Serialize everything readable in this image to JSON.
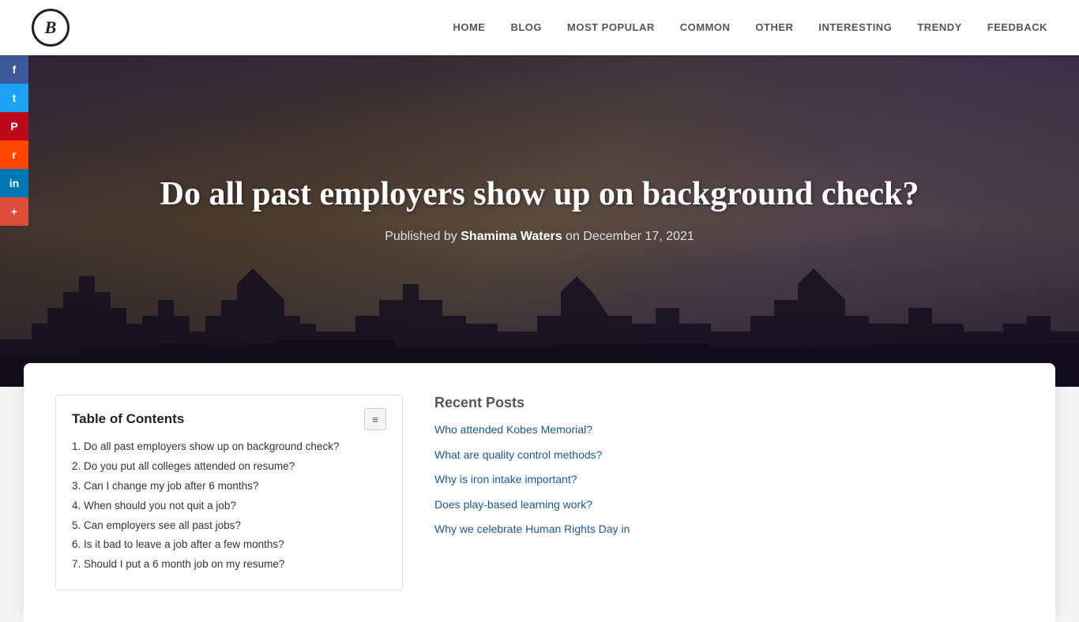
{
  "navbar": {
    "logo_letter": "B",
    "links": [
      {
        "label": "HOME",
        "href": "#"
      },
      {
        "label": "BLOG",
        "href": "#"
      },
      {
        "label": "MOST POPULAR",
        "href": "#"
      },
      {
        "label": "COMMON",
        "href": "#"
      },
      {
        "label": "OTHER",
        "href": "#"
      },
      {
        "label": "INTERESTING",
        "href": "#"
      },
      {
        "label": "TRENDY",
        "href": "#"
      },
      {
        "label": "FEEDBACK",
        "href": "#"
      }
    ]
  },
  "hero": {
    "title": "Do all past employers show up on background check?",
    "meta_prefix": "Published by ",
    "author": "Shamima Waters",
    "meta_suffix": " on December 17, 2021"
  },
  "social": {
    "buttons": [
      {
        "label": "f",
        "name": "facebook"
      },
      {
        "label": "t",
        "name": "twitter"
      },
      {
        "label": "P",
        "name": "pinterest"
      },
      {
        "label": "r",
        "name": "reddit"
      },
      {
        "label": "in",
        "name": "linkedin"
      },
      {
        "label": "+",
        "name": "googleplus"
      }
    ]
  },
  "toc": {
    "title": "Table of Contents",
    "toggle_icon": "≡",
    "items": [
      {
        "number": "1",
        "text": "Do all past employers show up on background check?"
      },
      {
        "number": "2",
        "text": "Do you put all colleges attended on resume?"
      },
      {
        "number": "3",
        "text": "Can I change my job after 6 months?"
      },
      {
        "number": "4",
        "text": "When should you not quit a job?"
      },
      {
        "number": "5",
        "text": "Can employers see all past jobs?"
      },
      {
        "number": "6",
        "text": "Is it bad to leave a job after a few months?"
      },
      {
        "number": "7",
        "text": "Should I put a 6 month job on my resume?"
      }
    ]
  },
  "sidebar": {
    "recent_posts_title": "Recent Posts",
    "posts": [
      {
        "text": "Who attended Kobes Memorial?"
      },
      {
        "text": "What are quality control methods?"
      },
      {
        "text": "Why is iron intake important?"
      },
      {
        "text": "Does play-based learning work?"
      },
      {
        "text": "Why we celebrate Human Rights Day in"
      }
    ]
  }
}
